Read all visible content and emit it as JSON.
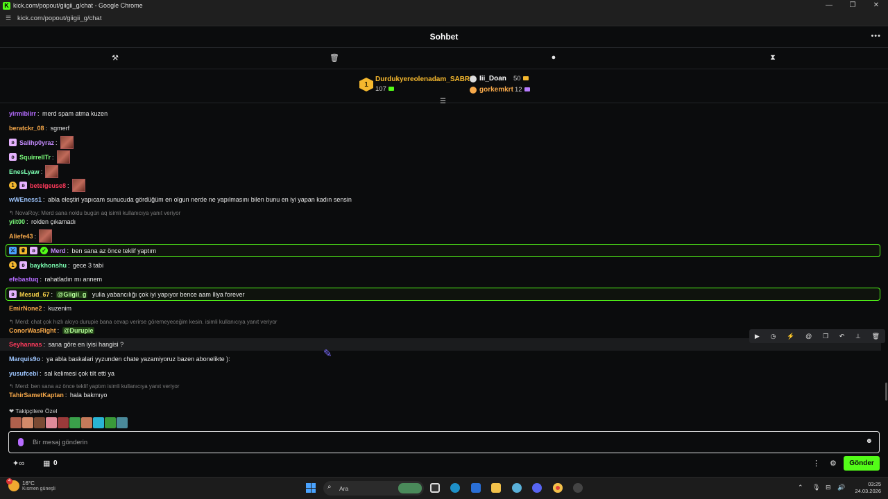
{
  "browser": {
    "window_title": "kick.com/popout/giigii_g/chat - Google Chrome",
    "url": "kick.com/popout/giigii_g/chat"
  },
  "chat": {
    "title": "Sohbet",
    "leaderboard": {
      "first": {
        "rank": "1",
        "name": "Durdukyereolenadam_SABRI",
        "score": "107"
      },
      "second": {
        "name": "Iii_Doan",
        "score": "50"
      },
      "third": {
        "name": "gorkemkrt",
        "score": "12"
      }
    },
    "messages": [
      {
        "user": "yirmibiirr",
        "color": "#b56cff",
        "text": "merd spam atma kuzen"
      },
      {
        "user": "beratckr_08",
        "color": "#f7a94a",
        "text": "sgmerf"
      },
      {
        "user": "Salihp0yraz",
        "color": "#c58cff",
        "text": ""
      },
      {
        "user": "SquirrellTr",
        "color": "#7cff7c",
        "text": ""
      },
      {
        "user": "EnesLyaw",
        "color": "#7cffb2",
        "text": ""
      },
      {
        "user": "betelgeuse8",
        "color": "#ff3a5c",
        "text": ""
      },
      {
        "user": "wWEness1",
        "color": "#9ec6ff",
        "text": "abla eleştiri yapıcam sunucuda gördüğüm en olgun nerde ne yapılmasını bilen bunu en iyi yapan kadın sensin"
      },
      {
        "reply": "NovaRoy: Merd sana noldu bugün aq isimli kullanıcıya yanıt veriyor",
        "user": "yiit00",
        "color": "#7cff7c",
        "text": "rolden çıkamadı"
      },
      {
        "user": "Aliefe43",
        "color": "#f7a94a",
        "text": ""
      },
      {
        "user": "Merd",
        "color": "#c58cff",
        "text": "ben sana az önce teklif yaptım"
      },
      {
        "user": "baykhonshu",
        "color": "#7cffb2",
        "text": "gece 3 tabi"
      },
      {
        "user": "efebastuq",
        "color": "#b56cff",
        "text": "rahatladın mı annem"
      },
      {
        "user": "Mesud_67",
        "color": "#f7d14a",
        "mention": "@Giigii_g",
        "text": "yulia yabancılığı çok iyi yapıyor bence aam lliya forever"
      },
      {
        "user": "EmirNone2",
        "color": "#f7a94a",
        "text": "kuzenim"
      },
      {
        "reply": "Merd: chat çok hızlı akıyo durupie bana cevap verirse göremeyeceğim kesin. isimli kullanıcıya yanıt veriyor",
        "user": "ConorWasRight",
        "color": "#f7a94a",
        "mention": "@Durupie",
        "text": ""
      },
      {
        "user": "Seyhannas",
        "color": "#ff3a5c",
        "text": "sana göre en iyisi hangisi ?"
      },
      {
        "user": "Marquis9o",
        "color": "#9ec6ff",
        "text": "ya abla baskalari yyzunden chate yazamiyoruz bazen abonelikte ):"
      },
      {
        "user": "yusufcebi",
        "color": "#9ec6ff",
        "text": "sal kelimesi çok tilt etti ya"
      },
      {
        "reply": "Merd: ben sana az önce teklif yaptım isimli kullanıcıya yanıt veriyor",
        "user": "TahirSametKaptan",
        "color": "#f7a94a",
        "text": "hala bakmıyo"
      }
    ],
    "followers_label": "Takipçilere Özel",
    "input_placeholder": "Bir mesaj gönderin",
    "points": "0",
    "send_label": "Gönder"
  },
  "taskbar": {
    "weather_badge": "4",
    "temperature": "16°C",
    "weather_desc": "Kısmen güneşli",
    "search_placeholder": "Ara",
    "time": "03:25",
    "date": "24.03.2026"
  }
}
